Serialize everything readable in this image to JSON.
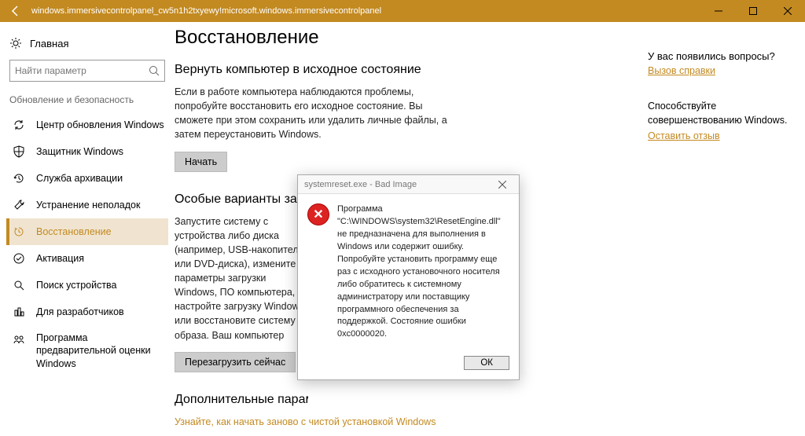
{
  "titlebar": {
    "title": "windows.immersivecontrolpanel_cw5n1h2txyewy!microsoft.windows.immersivecontrolpanel"
  },
  "sidebar": {
    "home": "Главная",
    "search_placeholder": "Найти параметр",
    "section": "Обновление и безопасность",
    "items": [
      {
        "label": "Центр обновления Windows",
        "icon": "sync"
      },
      {
        "label": "Защитник Windows",
        "icon": "shield"
      },
      {
        "label": "Служба архивации",
        "icon": "backup"
      },
      {
        "label": "Устранение неполадок",
        "icon": "troubleshoot"
      },
      {
        "label": "Восстановление",
        "icon": "recovery",
        "active": true
      },
      {
        "label": "Активация",
        "icon": "activation"
      },
      {
        "label": "Поиск устройства",
        "icon": "find"
      },
      {
        "label": "Для разработчиков",
        "icon": "dev"
      },
      {
        "label": "Программа предварительной оценки Windows",
        "icon": "insider"
      }
    ]
  },
  "main": {
    "title": "Восстановление",
    "reset": {
      "heading": "Вернуть компьютер в исходное состояние",
      "body": "Если в работе компьютера наблюдаются проблемы, попробуйте восстановить его исходное состояние. Вы сможете при этом сохранить или удалить личные файлы, а затем переустановить Windows.",
      "button": "Начать"
    },
    "advanced": {
      "heading": "Особые варианты загрузки",
      "body": "Запустите систему с устройства либо диска (например, USB-накопителя или DVD-диска), измените параметры загрузки Windows, ПО компьютера, настройте загрузку Windows или восстановите систему из образа. Ваш компьютер",
      "button": "Перезагрузить сейчас"
    },
    "more": {
      "heading": "Дополнительные параметры восстановления",
      "link": "Узнайте, как начать заново с чистой установкой Windows"
    }
  },
  "rightpane": {
    "q": "У вас появились вопросы?",
    "help": "Вызов справки",
    "body": "Способствуйте совершенствованию Windows.",
    "feedback": "Оставить отзыв"
  },
  "dialog": {
    "title": "systemreset.exe - Bad Image",
    "text": "Программа \"C:\\WINDOWS\\system32\\ResetEngine.dll\" не предназначена для выполнения в Windows или содержит ошибку. Попробуйте установить программу еще раз с исходного установочного носителя либо обратитесь к системному администратору или поставщику программного обеспечения за поддержкой. Состояние ошибки 0xc0000020.",
    "ok": "ОК"
  }
}
